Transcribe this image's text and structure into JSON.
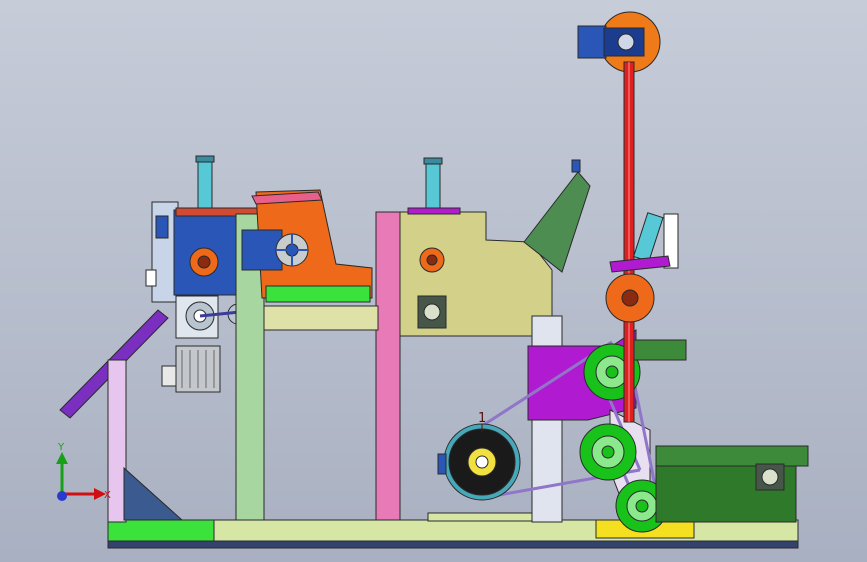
{
  "callout": {
    "label": "1"
  },
  "triad": {
    "y_label": "Y",
    "x_label": "X"
  },
  "colors": {
    "background_top": "#c6ccd8",
    "background_bottom": "#a9b0c1",
    "belt_red": "#e02020",
    "motor_blue": "#2a56b8",
    "pulley_green": "#18c21a",
    "frame_violet": "#b01bd1",
    "frame_khaki": "#d3d08a",
    "frame_pink": "#e87ab8",
    "cylinder_cyan": "#56c8d6",
    "gearbox_orange": "#ee6a1a",
    "base_green": "#3ce23c",
    "base_plate": "#d6e6a4"
  },
  "icons": [
    "coordinate-triad-icon",
    "callout-balloon-icon"
  ]
}
